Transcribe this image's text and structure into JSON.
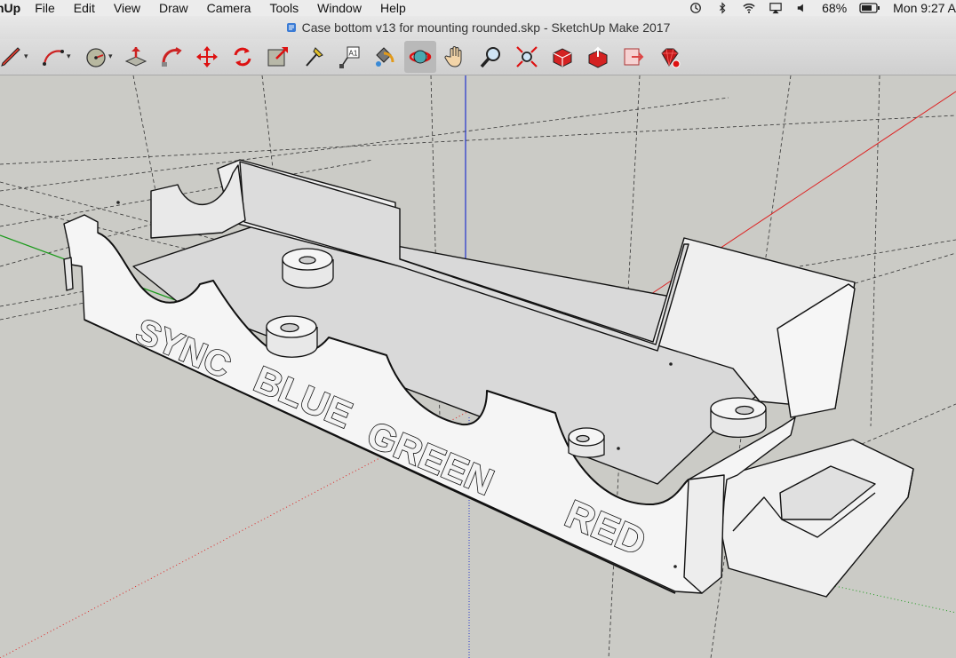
{
  "menubar": {
    "app_name": "hUp",
    "items": [
      "File",
      "Edit",
      "View",
      "Draw",
      "Camera",
      "Tools",
      "Window",
      "Help"
    ],
    "battery": "68%",
    "clock": "Mon 9:27 A",
    "status_icons": [
      "time-machine-icon",
      "bluetooth-icon",
      "wifi-icon",
      "airplay-icon",
      "volume-icon",
      "battery-icon"
    ]
  },
  "window": {
    "title": "Case bottom v13 for mounting rounded.skp - SketchUp Make 2017"
  },
  "toolbar": {
    "tools": [
      {
        "name": "line-tool",
        "icon": "pencil-icon"
      },
      {
        "name": "arc-tool",
        "icon": "arc-icon"
      },
      {
        "name": "circle-tool",
        "icon": "circle-icon"
      },
      {
        "name": "push-pull-tool",
        "icon": "push-pull-icon"
      },
      {
        "name": "follow-me-tool",
        "icon": "follow-me-icon"
      },
      {
        "name": "move-tool",
        "icon": "move-icon"
      },
      {
        "name": "rotate-tool",
        "icon": "rotate-icon"
      },
      {
        "name": "scale-tool",
        "icon": "scale-icon"
      },
      {
        "name": "tape-measure-tool",
        "icon": "tape-icon"
      },
      {
        "name": "text-tool",
        "icon": "text-icon"
      },
      {
        "name": "paint-bucket-tool",
        "icon": "paint-bucket-icon"
      },
      {
        "name": "orbit-tool",
        "icon": "orbit-icon",
        "active": true
      },
      {
        "name": "pan-tool",
        "icon": "hand-icon"
      },
      {
        "name": "zoom-tool",
        "icon": "zoom-icon"
      },
      {
        "name": "zoom-extents-tool",
        "icon": "zoom-extents-icon"
      },
      {
        "name": "warehouse-tool",
        "icon": "warehouse-icon"
      },
      {
        "name": "share-model-tool",
        "icon": "share-icon"
      },
      {
        "name": "send-to-layout-tool",
        "icon": "layout-icon"
      },
      {
        "name": "extension-warehouse-tool",
        "icon": "ruby-icon"
      }
    ],
    "text_tool_glyph": "A1"
  },
  "model": {
    "labels": [
      "SYNC",
      "BLUE",
      "GREEN",
      "RED"
    ],
    "axis_colors": {
      "red": "#d22",
      "green": "#1a9a1a",
      "blue": "#2233cc"
    },
    "surface_color": "#f4f4f4",
    "background_color": "#cbcbc6"
  }
}
